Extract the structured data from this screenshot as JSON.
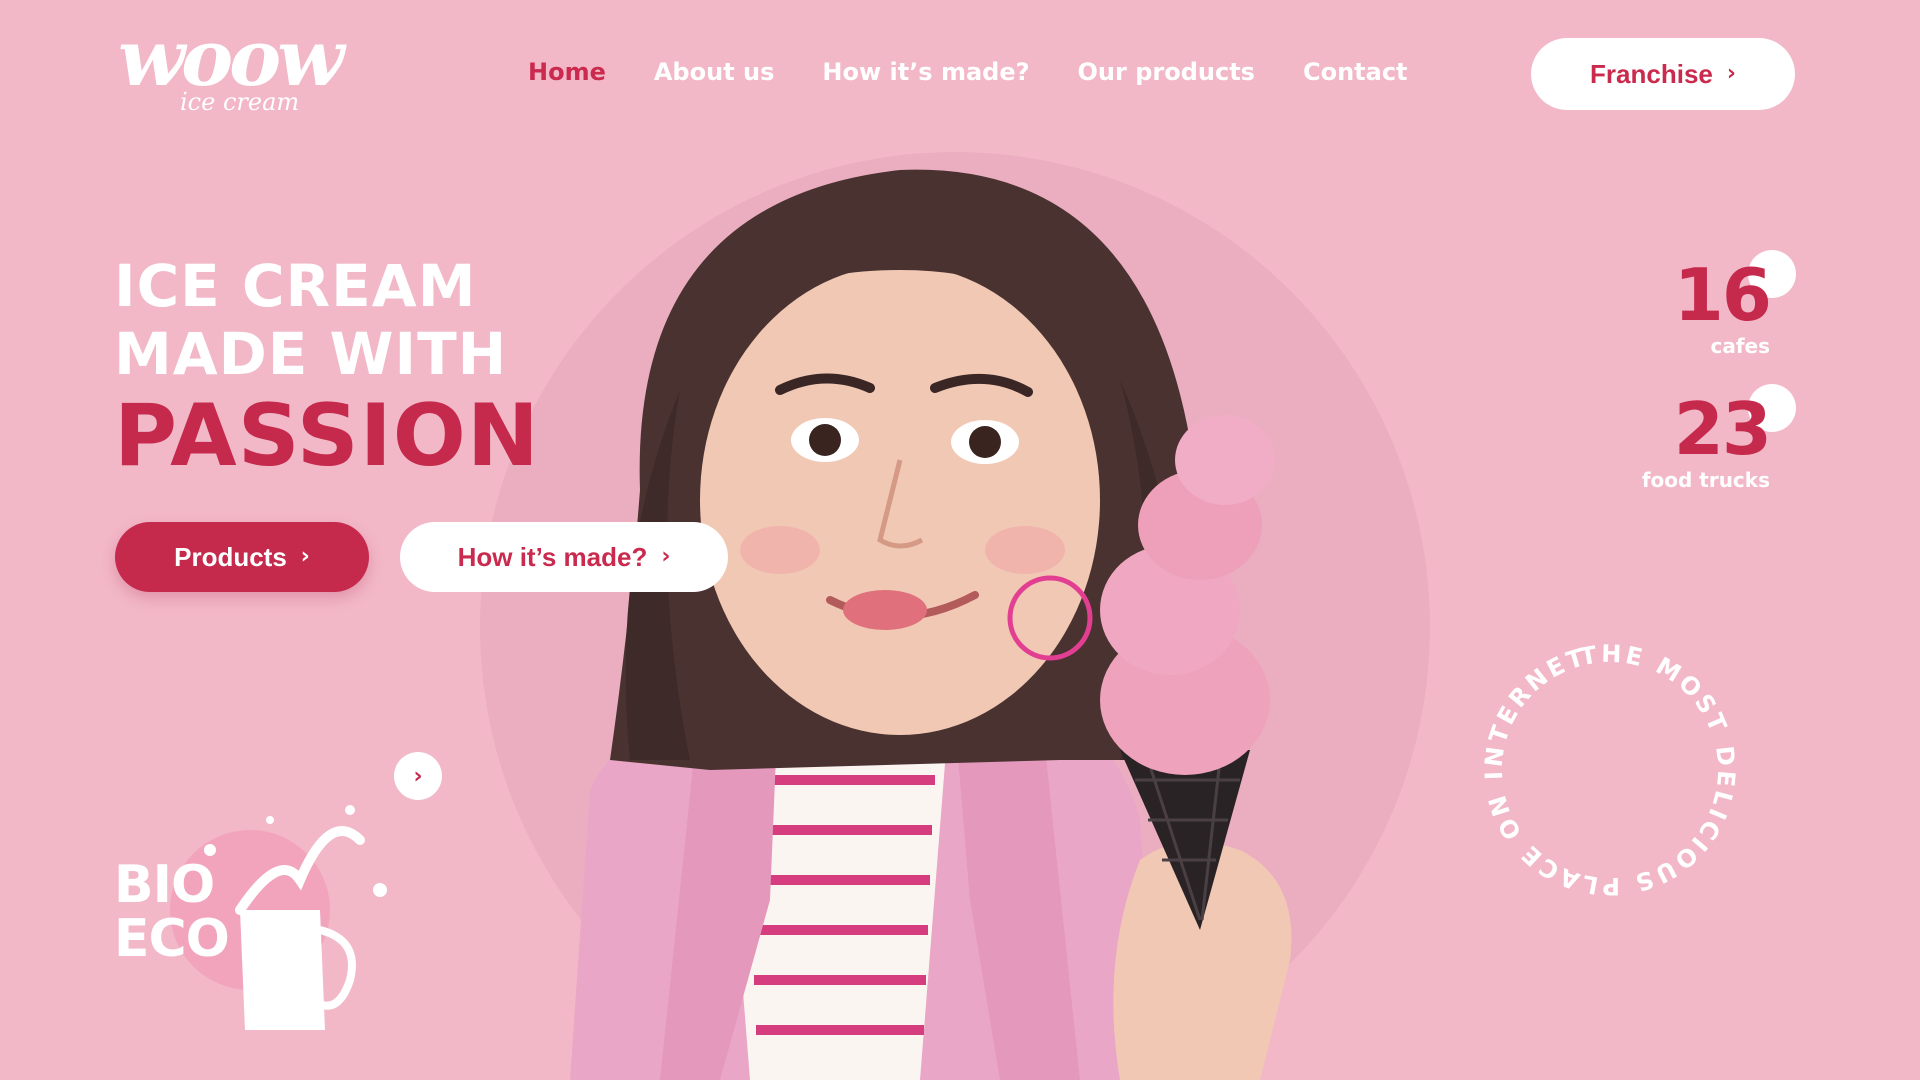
{
  "logo": {
    "word": "woow",
    "sub": "ice cream"
  },
  "nav": {
    "items": [
      {
        "label": "Home",
        "active": true
      },
      {
        "label": "About us",
        "active": false
      },
      {
        "label": "How it’s made?",
        "active": false
      },
      {
        "label": "Our products",
        "active": false
      },
      {
        "label": "Contact",
        "active": false
      }
    ]
  },
  "franchise_button": {
    "label": "Franchise",
    "icon": "chevron-right-icon"
  },
  "hero": {
    "line1": "ICE CREAM",
    "line2": "MADE WITH",
    "line3": "PASSION",
    "products_button": "Products",
    "how_button": "How it’s made?"
  },
  "stats": [
    {
      "value": "16",
      "label": "cafes"
    },
    {
      "value": "23",
      "label": "food trucks"
    }
  ],
  "badge": {
    "text": "THE MOST DELICIOUS PLACE ON INTERNET!"
  },
  "bio_card": {
    "line1": "BIO",
    "line2": "ECO",
    "icon": "chevron-right-icon"
  },
  "colors": {
    "background": "#f2b8c8",
    "circle": "#eaaec0",
    "accent": "#c52a4c",
    "white": "#ffffff"
  }
}
